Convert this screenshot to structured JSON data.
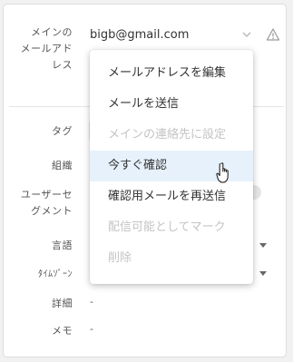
{
  "contact": {
    "main_email_label": "メインの\nメールアド\nレス",
    "email_value": "bigb@gmail.com"
  },
  "fields": {
    "tag_label": "タグ",
    "org_label": "組織",
    "segment_label": "ユーザーセ\nグメント",
    "language_label": "言語",
    "timezone_label": "ﾀｲﾑｿﾞｰﾝ",
    "detail_label": "詳細",
    "detail_value": "-",
    "memo_label": "メモ",
    "memo_value": "-"
  },
  "menu": {
    "items": [
      {
        "label": "メールアドレスを編集",
        "disabled": false
      },
      {
        "label": "メールを送信",
        "disabled": false
      },
      {
        "label": "メインの連絡先に設定",
        "disabled": true
      },
      {
        "label": "今すぐ確認",
        "disabled": false,
        "hover": true
      },
      {
        "label": "確認用メールを再送信",
        "disabled": false
      },
      {
        "label": "配信可能としてマーク",
        "disabled": true
      },
      {
        "label": "削除",
        "disabled": true
      }
    ]
  },
  "icons": {
    "dropdown": "chevron-down-icon",
    "warning": "warning-icon",
    "cursor": "hand-pointer-icon"
  },
  "colors": {
    "hover_bg": "#e7f1fb",
    "disabled_text": "#c4c4c4"
  }
}
